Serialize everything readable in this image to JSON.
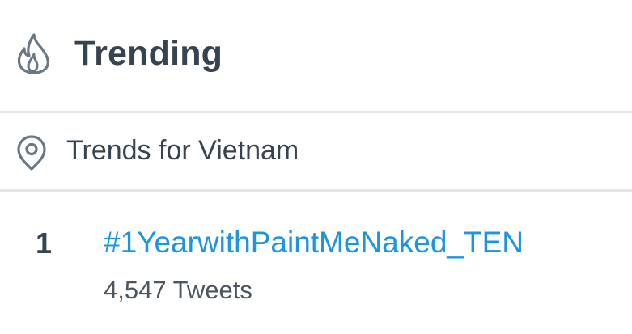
{
  "header": {
    "title": "Trending",
    "icon": "flame-icon"
  },
  "location": {
    "label": "Trends for Vietnam",
    "icon": "location-pin-icon"
  },
  "trends": [
    {
      "rank": "1",
      "hashtag": "#1YearwithPaintMeNaked_TEN",
      "tweets": "4,547 Tweets"
    }
  ],
  "colors": {
    "text_dark": "#364350",
    "link_blue": "#1b95e0",
    "secondary_text": "#4b5661",
    "divider": "#e3e6e9"
  }
}
